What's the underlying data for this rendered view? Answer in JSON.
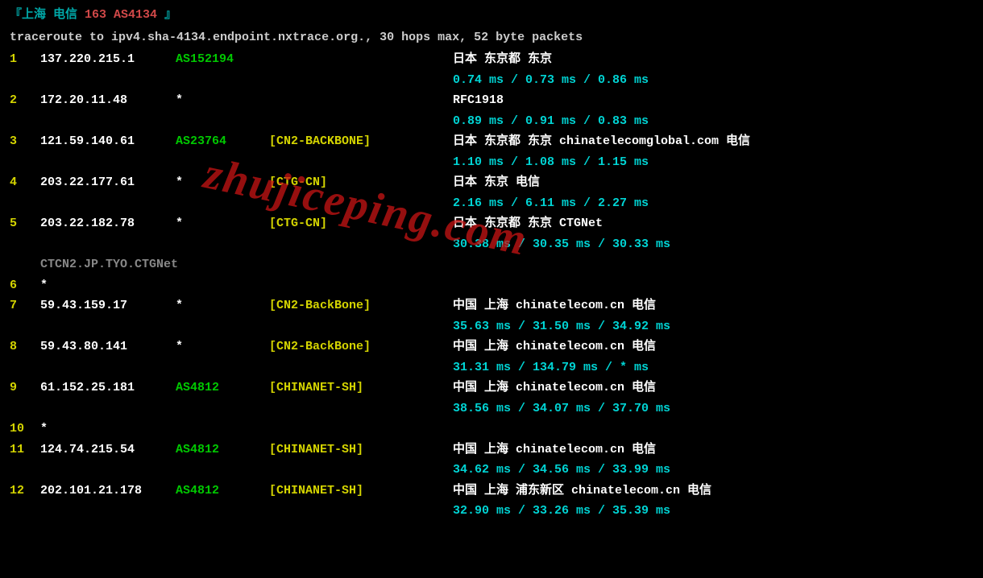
{
  "header": {
    "bracket_open": "『",
    "location": "上海 电信",
    "asn": "163 AS4134",
    "bracket_close": "』"
  },
  "subheader": "traceroute to ipv4.sha-4134.endpoint.nxtrace.org., 30 hops max, 52 byte packets",
  "watermark": "zhujiceping.com",
  "hops": [
    {
      "num": "1",
      "ip": "137.220.215.1",
      "asn": "AS152194",
      "tag": "",
      "location": "日本 东京都 东京",
      "latency": "0.74 ms / 0.73 ms / 0.86 ms"
    },
    {
      "num": "2",
      "ip": "172.20.11.48",
      "asn": "*",
      "tag": "",
      "location": "RFC1918",
      "latency": "0.89 ms / 0.91 ms / 0.83 ms"
    },
    {
      "num": "3",
      "ip": "121.59.140.61",
      "asn": "AS23764",
      "tag": "[CN2-BACKBONE]",
      "location": "日本 东京都 东京  chinatelecomglobal.com  电信",
      "latency": "1.10 ms / 1.08 ms / 1.15 ms"
    },
    {
      "num": "4",
      "ip": "203.22.177.61",
      "asn": "*",
      "tag": "[CTG-CN]",
      "location": "日本 东京   电信",
      "latency": "2.16 ms / 6.11 ms / 2.27 ms"
    },
    {
      "num": "5",
      "ip": "203.22.182.78",
      "asn": "*",
      "tag": "[CTG-CN]",
      "location": "日本 东京都 东京  CTGNet",
      "latency": "30.38 ms / 30.35 ms / 30.33 ms",
      "subtext": "CTCN2.JP.TYO.CTGNet"
    },
    {
      "num": "6",
      "star_only": "*"
    },
    {
      "num": "7",
      "ip": "59.43.159.17",
      "asn": "*",
      "tag": "[CN2-BackBone]",
      "location": "中国 上海   chinatelecom.cn  电信",
      "latency": "35.63 ms / 31.50 ms / 34.92 ms"
    },
    {
      "num": "8",
      "ip": "59.43.80.141",
      "asn": "*",
      "tag": "[CN2-BackBone]",
      "location": "中国 上海   chinatelecom.cn  电信",
      "latency": "31.31 ms / 134.79 ms / * ms"
    },
    {
      "num": "9",
      "ip": "61.152.25.181",
      "asn": "AS4812",
      "tag": "[CHINANET-SH]",
      "location": "中国 上海   chinatelecom.cn  电信",
      "latency": "38.56 ms / 34.07 ms / 37.70 ms"
    },
    {
      "num": "10",
      "star_only": "*"
    },
    {
      "num": "11",
      "ip": "124.74.215.54",
      "asn": "AS4812",
      "tag": "[CHINANET-SH]",
      "location": "中国 上海   chinatelecom.cn  电信",
      "latency": "34.62 ms / 34.56 ms / 33.99 ms"
    },
    {
      "num": "12",
      "ip": "202.101.21.178",
      "asn": "AS4812",
      "tag": "[CHINANET-SH]",
      "location": "中国 上海  浦东新区 chinatelecom.cn  电信",
      "latency": "32.90 ms / 33.26 ms / 35.39 ms"
    }
  ]
}
